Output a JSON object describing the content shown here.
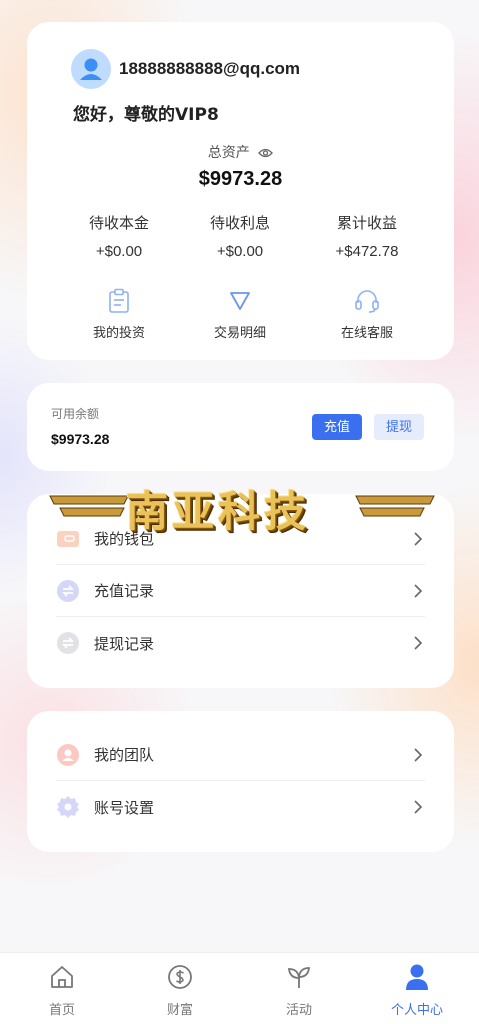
{
  "profile": {
    "email": "18888888888@qq.com",
    "greeting": "您好，尊敬的VIP8",
    "total_assets_label": "总资产",
    "total_assets_value": "$9973.28",
    "stats": [
      {
        "label": "待收本金",
        "value": "+$0.00"
      },
      {
        "label": "待收利息",
        "value": "+$0.00"
      },
      {
        "label": "累计收益",
        "value": "+$472.78"
      }
    ],
    "quick_links": [
      {
        "label": "我的投资",
        "icon": "clipboard-icon"
      },
      {
        "label": "交易明细",
        "icon": "triangle-down-icon"
      },
      {
        "label": "在线客服",
        "icon": "headset-icon"
      }
    ]
  },
  "balance": {
    "label": "可用余额",
    "value": "$9973.28",
    "recharge_label": "充值",
    "withdraw_label": "提现"
  },
  "watermark": {
    "text": "南亚科技"
  },
  "menu_primary": [
    {
      "label": "我的钱包",
      "icon": "wallet-icon"
    },
    {
      "label": "充值记录",
      "icon": "exchange-icon"
    },
    {
      "label": "提现记录",
      "icon": "exchange-gray-icon"
    }
  ],
  "menu_secondary": [
    {
      "label": "我的团队",
      "icon": "team-icon"
    },
    {
      "label": "账号设置",
      "icon": "settings-icon"
    }
  ],
  "bottom_nav": [
    {
      "label": "首页",
      "icon": "home-icon",
      "active": false
    },
    {
      "label": "财富",
      "icon": "dollar-icon",
      "active": false
    },
    {
      "label": "活动",
      "icon": "sprout-icon",
      "active": false
    },
    {
      "label": "个人中心",
      "icon": "user-icon",
      "active": true
    }
  ],
  "colors": {
    "accent": "#3a6ff0",
    "watermark_gold": "#e9c25a"
  }
}
